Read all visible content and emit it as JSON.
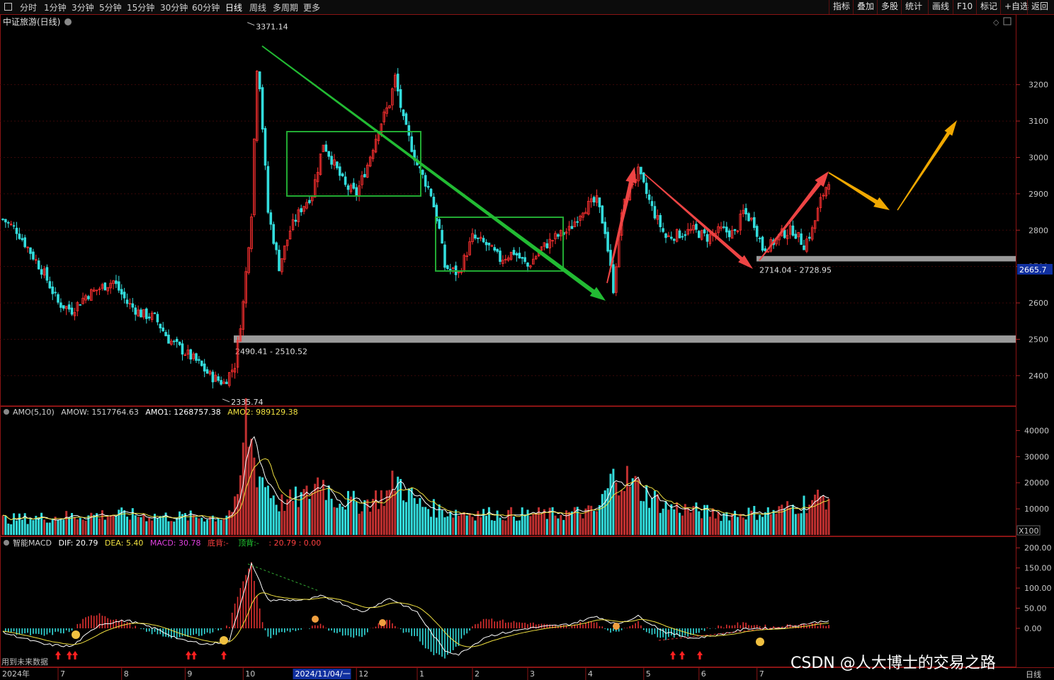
{
  "toolbar": {
    "periods": [
      "分时",
      "1分钟",
      "3分钟",
      "5分钟",
      "15分钟",
      "30分钟",
      "60分钟",
      "日线",
      "周线",
      "多周期",
      "更多"
    ],
    "active_period": "日线",
    "right_buttons": [
      "指标",
      "叠加",
      "多股",
      "统计",
      "画线",
      "F10",
      "标记",
      "+自选",
      "返回"
    ]
  },
  "chart_title": "中证旅游(日线)",
  "watermark": "CSDN @人大博士的交易之路",
  "footer_note": "用到未来数据",
  "period_badge": "日线",
  "colors": {
    "up": "#ff3030",
    "down": "#33dddd",
    "box": "#22aa33",
    "green_arrow": "#22bb33",
    "red_arrow": "#ee4444",
    "yellow_arrow": "#f0a800",
    "zone": "#9a9a9a"
  },
  "chart_data": [
    {
      "type": "candlestick",
      "name": "price",
      "y_ticks": [
        2400,
        2500,
        2600,
        2700,
        2800,
        2900,
        3000,
        3100,
        3200
      ],
      "ylim": [
        2320,
        3390
      ],
      "last_price_label": "2665.7",
      "annotations": {
        "high": {
          "value": 3371.14,
          "text": "3371.14"
        },
        "low": {
          "value": 2335.74,
          "text": "2335.74"
        },
        "zone_low": {
          "from": 2490.41,
          "to": 2510.52,
          "text": "2490.41 - 2510.52"
        },
        "zone_mid": {
          "from": 2714.04,
          "to": 2728.95,
          "text": "2714.04 - 2728.95"
        }
      },
      "waypoints": [
        [
          0,
          2830
        ],
        [
          5,
          2800
        ],
        [
          10,
          2740
        ],
        [
          15,
          2680
        ],
        [
          20,
          2600
        ],
        [
          25,
          2580
        ],
        [
          30,
          2620
        ],
        [
          35,
          2640
        ],
        [
          40,
          2660
        ],
        [
          45,
          2600
        ],
        [
          50,
          2570
        ],
        [
          55,
          2560
        ],
        [
          60,
          2500
        ],
        [
          65,
          2470
        ],
        [
          70,
          2440
        ],
        [
          75,
          2400
        ],
        [
          80,
          2380
        ],
        [
          84,
          2430
        ],
        [
          87,
          2600
        ],
        [
          90,
          2850
        ],
        [
          92,
          3250
        ],
        [
          93,
          3200
        ],
        [
          96,
          2850
        ],
        [
          100,
          2700
        ],
        [
          104,
          2800
        ],
        [
          108,
          2860
        ],
        [
          112,
          2900
        ],
        [
          116,
          3040
        ],
        [
          120,
          2980
        ],
        [
          124,
          2920
        ],
        [
          128,
          2900
        ],
        [
          132,
          2980
        ],
        [
          136,
          3080
        ],
        [
          140,
          3150
        ],
        [
          142,
          3220
        ],
        [
          145,
          3100
        ],
        [
          150,
          2980
        ],
        [
          155,
          2900
        ],
        [
          158,
          2800
        ],
        [
          160,
          2700
        ],
        [
          165,
          2680
        ],
        [
          170,
          2780
        ],
        [
          175,
          2760
        ],
        [
          180,
          2720
        ],
        [
          185,
          2740
        ],
        [
          190,
          2700
        ],
        [
          195,
          2750
        ],
        [
          200,
          2780
        ],
        [
          205,
          2800
        ],
        [
          210,
          2860
        ],
        [
          215,
          2880
        ],
        [
          218,
          2800
        ],
        [
          221,
          2640
        ],
        [
          224,
          2850
        ],
        [
          227,
          2920
        ],
        [
          230,
          2960
        ],
        [
          235,
          2860
        ],
        [
          240,
          2780
        ],
        [
          245,
          2790
        ],
        [
          250,
          2800
        ],
        [
          255,
          2780
        ],
        [
          260,
          2800
        ],
        [
          265,
          2790
        ],
        [
          268,
          2850
        ],
        [
          272,
          2820
        ],
        [
          275,
          2750
        ],
        [
          278,
          2760
        ],
        [
          282,
          2790
        ],
        [
          286,
          2800
        ],
        [
          290,
          2760
        ],
        [
          293,
          2800
        ],
        [
          296,
          2880
        ],
        [
          299,
          2940
        ]
      ],
      "ohlc_note": "candles generated along waypoints"
    },
    {
      "type": "bar",
      "name": "AMO",
      "legend": "AMO(5,10)",
      "values_text": {
        "AMOW": "1517764.63",
        "AMO1": "1268757.38",
        "AMO2": "989129.38"
      },
      "y_ticks": [
        10000,
        20000,
        30000,
        40000
      ],
      "ylim": [
        0,
        45000
      ],
      "unit_badge": "X100",
      "waypoints": [
        [
          0,
          6000
        ],
        [
          20,
          7000
        ],
        [
          40,
          8000
        ],
        [
          60,
          7000
        ],
        [
          80,
          7000
        ],
        [
          85,
          12000
        ],
        [
          88,
          44000
        ],
        [
          92,
          25000
        ],
        [
          100,
          12000
        ],
        [
          110,
          15000
        ],
        [
          115,
          22000
        ],
        [
          120,
          14000
        ],
        [
          130,
          12000
        ],
        [
          140,
          16000
        ],
        [
          142,
          22000
        ],
        [
          150,
          12000
        ],
        [
          160,
          9000
        ],
        [
          180,
          8000
        ],
        [
          200,
          8000
        ],
        [
          215,
          9000
        ],
        [
          222,
          24000
        ],
        [
          230,
          18000
        ],
        [
          240,
          11000
        ],
        [
          260,
          8000
        ],
        [
          280,
          9000
        ],
        [
          299,
          15000
        ]
      ]
    },
    {
      "type": "bar",
      "name": "MACD",
      "legend": "智能MACD",
      "values_text": {
        "DIF": "20.79",
        "DEA": "5.40",
        "MACD": "30.78",
        "bottom_div": "底背:-",
        "top_div": "顶背:-",
        "extra": ": 20.79 : 0.00"
      },
      "y_ticks": [
        0.0,
        50.0,
        100.0,
        150.0,
        200.0
      ],
      "ylim": [
        -95,
        225
      ],
      "waypoints": [
        [
          0,
          -10
        ],
        [
          15,
          -40
        ],
        [
          25,
          -45
        ],
        [
          35,
          10
        ],
        [
          45,
          20
        ],
        [
          55,
          0
        ],
        [
          65,
          -30
        ],
        [
          75,
          -40
        ],
        [
          82,
          -30
        ],
        [
          86,
          60
        ],
        [
          90,
          160
        ],
        [
          96,
          70
        ],
        [
          110,
          70
        ],
        [
          115,
          80
        ],
        [
          120,
          70
        ],
        [
          130,
          40
        ],
        [
          140,
          75
        ],
        [
          150,
          40
        ],
        [
          155,
          -10
        ],
        [
          160,
          -55
        ],
        [
          165,
          -65
        ],
        [
          175,
          -20
        ],
        [
          190,
          0
        ],
        [
          205,
          10
        ],
        [
          215,
          30
        ],
        [
          222,
          10
        ],
        [
          230,
          30
        ],
        [
          240,
          -10
        ],
        [
          250,
          -25
        ],
        [
          260,
          -15
        ],
        [
          270,
          0
        ],
        [
          280,
          0
        ],
        [
          299,
          20
        ]
      ]
    }
  ],
  "x_axis": {
    "year_label": "2024年",
    "months": [
      {
        "label": "7",
        "idx": 20
      },
      {
        "label": "8",
        "idx": 43
      },
      {
        "label": "9",
        "idx": 66
      },
      {
        "label": "10",
        "idx": 87
      },
      {
        "label": "12",
        "idx": 128
      },
      {
        "label": "1",
        "idx": 150
      },
      {
        "label": "2",
        "idx": 170
      },
      {
        "label": "3",
        "idx": 190
      },
      {
        "label": "4",
        "idx": 211
      },
      {
        "label": "5",
        "idx": 232
      },
      {
        "label": "6",
        "idx": 252
      },
      {
        "label": "7",
        "idx": 273
      }
    ],
    "cursor_date": "2024/11/04/一",
    "cursor_idx": 105
  }
}
